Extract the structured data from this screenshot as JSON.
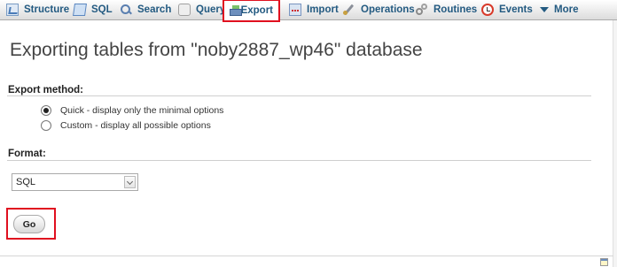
{
  "tabs": [
    {
      "id": "structure",
      "label": "Structure",
      "icon": "structure-icon"
    },
    {
      "id": "sql",
      "label": "SQL",
      "icon": "sql-icon"
    },
    {
      "id": "search",
      "label": "Search",
      "icon": "search-icon"
    },
    {
      "id": "query",
      "label": "Query",
      "icon": "query-icon"
    },
    {
      "id": "export",
      "label": "Export",
      "icon": "export-icon",
      "active": true
    },
    {
      "id": "import",
      "label": "Import",
      "icon": "import-icon"
    },
    {
      "id": "operations",
      "label": "Operations",
      "icon": "operations-icon"
    },
    {
      "id": "routines",
      "label": "Routines",
      "icon": "routines-icon"
    },
    {
      "id": "events",
      "label": "Events",
      "icon": "events-icon"
    },
    {
      "id": "more",
      "label": "More",
      "icon": "chevron-down-icon"
    }
  ],
  "page": {
    "title": "Exporting tables from \"noby2887_wp46\" database"
  },
  "export_method": {
    "heading": "Export method:",
    "options": [
      {
        "label": "Quick - display only the minimal options",
        "checked": true
      },
      {
        "label": "Custom - display all possible options",
        "checked": false
      }
    ]
  },
  "format": {
    "heading": "Format:",
    "selected": "SQL"
  },
  "go_label": "Go",
  "colors": {
    "highlight": "#e0101f",
    "tab_text": "#235a81"
  }
}
